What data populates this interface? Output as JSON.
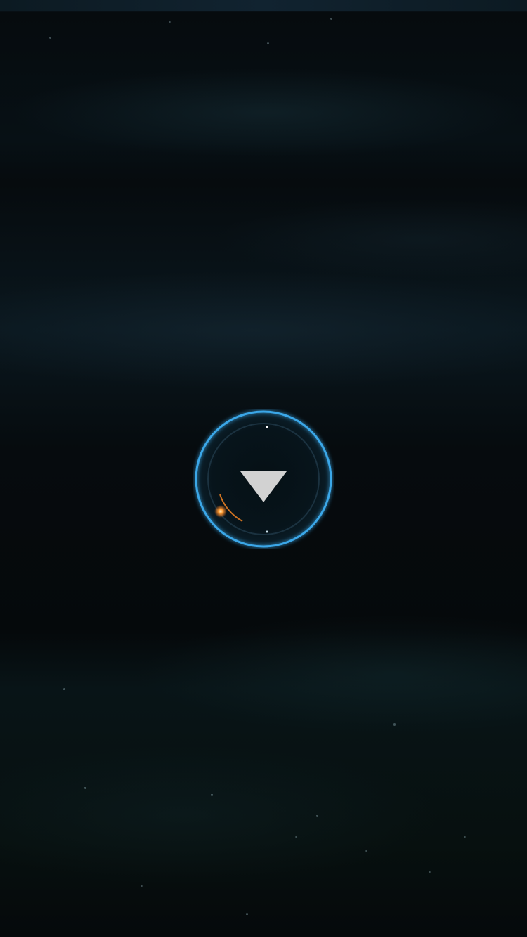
{
  "screen": {
    "background_color": "#050a0d",
    "accent_color": "#3aa7e8",
    "flare_color": "#ff9a2e"
  },
  "down_button": {
    "icon": "triangle-down-icon",
    "icon_color": "#d2d2d2"
  }
}
